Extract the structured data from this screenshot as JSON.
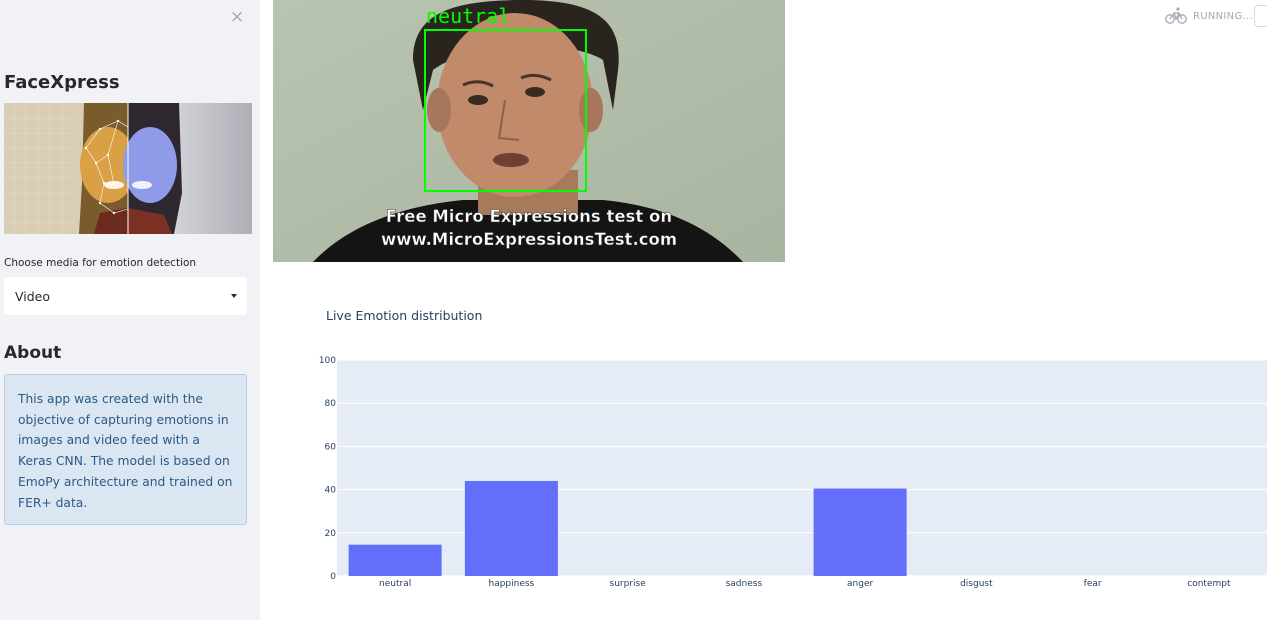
{
  "sidebar": {
    "close_symbol": "×",
    "app_title": "FaceXpress",
    "media_label": "Choose media for emotion detection",
    "media_selected": "Video",
    "about_title": "About",
    "about_text": "This app was created with the objective of capturing emotions in images and video feed with a Keras CNN. The model is based on EmoPy architecture and trained on FER+ data."
  },
  "video": {
    "detected_label": "neutral",
    "caption_line1": "Free Micro Expressions test on",
    "caption_line2": "www.MicroExpressionsTest.com"
  },
  "status": {
    "icon": "running-bicycle-icon",
    "text": "RUNNING..."
  },
  "chart_title": "Live Emotion distribution",
  "colors": {
    "bar": "#636efa",
    "plot_bg": "#e5ecf6",
    "box": "#00ff00"
  },
  "chart_data": {
    "type": "bar",
    "title": "Live Emotion distribution",
    "categories": [
      "neutral",
      "happiness",
      "surprise",
      "sadness",
      "anger",
      "disgust",
      "fear",
      "contempt"
    ],
    "values": [
      14.5,
      44,
      0,
      0,
      40.5,
      0,
      0,
      0
    ],
    "ylim": [
      0,
      100
    ],
    "yticks": [
      0,
      20,
      40,
      60,
      80,
      100
    ],
    "grid": true,
    "legend": "none"
  }
}
